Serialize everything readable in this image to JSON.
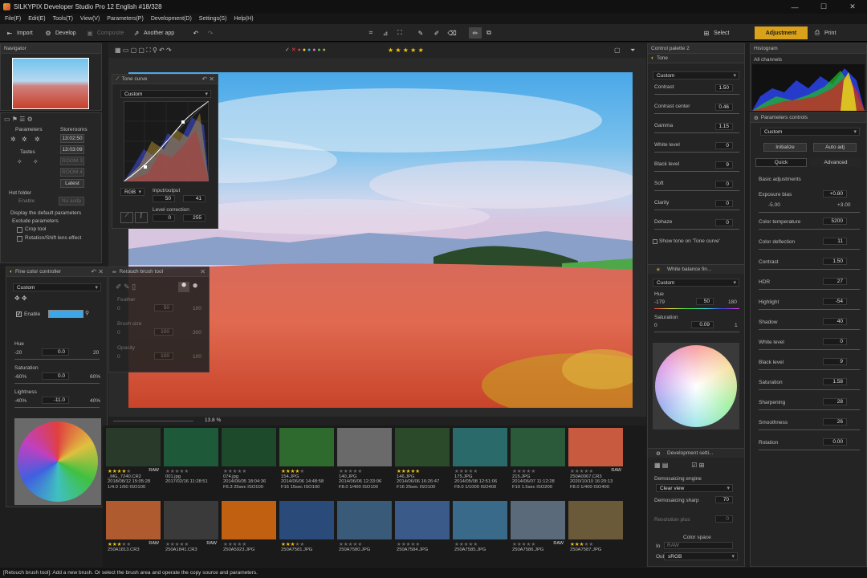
{
  "window": {
    "title": "SILKYPIX Developer Studio Pro 12 English  #18/328",
    "min": "—",
    "max": "☐",
    "close": "✕"
  },
  "menu": [
    "File(F)",
    "Edit(E)",
    "Tools(T)",
    "View(V)",
    "Parameters(P)",
    "Development(D)",
    "Settings(S)",
    "Help(H)"
  ],
  "toolbar": {
    "import": "Import",
    "develop": "Develop",
    "composite": "Composite",
    "another_app": "Another app",
    "select": "Select",
    "adjustment": "Adjustment",
    "print": "Print",
    "accent": "#d9a21a"
  },
  "navigator": {
    "title": "Navigator"
  },
  "left_panel": {
    "parameters": "Parameters",
    "storerooms": "Storerooms",
    "tastes": "Tastes",
    "store_times": [
      "13:02:50",
      "13:03:09",
      "ROOM 3",
      "ROOM 4"
    ],
    "latest": "Latest",
    "hot_folder": "Hot folder",
    "enable": "Enable",
    "no_asdp": "No asdp",
    "display_defaults": "Display the default parameters",
    "exclude": "Exclude parameters",
    "crop_tool": "Crop tool",
    "rotation": "Rotation/Shift lens effect"
  },
  "tone_curve": {
    "title": "Tone curve",
    "preset": "Custom",
    "channel": "RGB",
    "io_label": "Input/output",
    "input": "50",
    "output": "41",
    "level_label": "Level correction",
    "level_min": "0",
    "level_max": "255"
  },
  "fine_color": {
    "title": "Fine color controller",
    "preset": "Custom",
    "enable": "Enable",
    "hue": "Hue",
    "hue_min": "-20",
    "hue_val": "0.0",
    "hue_max": "20",
    "sat": "Saturation",
    "sat_min": "-60%",
    "sat_val": "0.0",
    "sat_max": "60%",
    "light": "Lightness",
    "light_min": "-40%",
    "light_val": "-11.0",
    "light_max": "40%",
    "swatch": "#3ba7e8"
  },
  "retouch": {
    "title": "Retouch brush tool",
    "feather": "Feather",
    "feather_min": "0",
    "feather_val": "50",
    "feather_max": "100",
    "brush": "Brush size",
    "brush_min": "0",
    "brush_val": "100",
    "brush_max": "300",
    "opacity": "Opacity",
    "opacity_min": "0",
    "opacity_val": "100",
    "opacity_max": "100"
  },
  "zoom": {
    "value": "13.8",
    "unit": "%"
  },
  "control_palette": {
    "title": "Control palette 2",
    "tone": {
      "title": "Tone",
      "preset": "Custom",
      "rows": [
        {
          "label": "Contrast",
          "value": "1.50"
        },
        {
          "label": "Contrast center",
          "value": "0.46"
        },
        {
          "label": "Gamma",
          "value": "1.15"
        },
        {
          "label": "White level",
          "value": "0"
        },
        {
          "label": "Black level",
          "value": "9"
        },
        {
          "label": "Soft",
          "value": "0"
        },
        {
          "label": "Clarity",
          "value": "0"
        },
        {
          "label": "Dehaze",
          "value": "0"
        }
      ],
      "show_tone": "Show tone on 'Tone curve'"
    },
    "wb": {
      "title": "White balance fin...",
      "preset": "Custom",
      "hue": "Hue",
      "hue_min": "-179",
      "hue_val": "50",
      "hue_max": "180",
      "sat": "Saturation",
      "sat_min": "0",
      "sat_val": "0.09",
      "sat_max": "1"
    },
    "dev": {
      "title": "Development setti...",
      "demosaic": "Demosaicing engine",
      "demosaic_val": "Clear view",
      "sharp": "Demosaicing sharp",
      "sharp_val": "70",
      "respl": "Resolution plus",
      "respl_val": "0",
      "colorspace": "Color space",
      "in_lbl": "In",
      "in_val": "RAW",
      "out_lbl": "Out",
      "out_val": "sRGB"
    }
  },
  "histogram": {
    "title": "Histogram",
    "channel": "All channels"
  },
  "params_controls": {
    "title": "Parameters controls",
    "preset": "Custom",
    "initialize": "Initialize",
    "auto_adj": "Auto adj",
    "quick": "Quick",
    "advanced": "Advanced",
    "basic": "Basic adjustments",
    "exposure": "Exposure bias",
    "exp_val": "+0.80",
    "exp_min": "-5.00",
    "exp_max": "+3.00",
    "rows": [
      {
        "label": "Color temperature",
        "value": "5200"
      },
      {
        "label": "Color deflection",
        "value": "11"
      },
      {
        "label": "Contrast",
        "value": "1.50"
      },
      {
        "label": "HDR",
        "value": "27"
      },
      {
        "label": "Highlight",
        "value": "-54"
      },
      {
        "label": "Shadow",
        "value": "40"
      },
      {
        "label": "White level",
        "value": "0"
      },
      {
        "label": "Black level",
        "value": "9"
      },
      {
        "label": "Saturation",
        "value": "1.58"
      },
      {
        "label": "Sharpening",
        "value": "28"
      },
      {
        "label": "Smoothness",
        "value": "26"
      },
      {
        "label": "Rotation",
        "value": "0.00"
      }
    ]
  },
  "thumbnails_row1": [
    {
      "stars": 4,
      "raw": "RAW",
      "meta": "_MG_7240.CR2\n2018/08/12 15:05:28\n1/4.0 1/60 ISO100",
      "bg": "#2a3a2a"
    },
    {
      "stars": 0,
      "raw": "",
      "meta": "001.jpg\n2017/02/16 11:28:51",
      "bg": "#1e5a3a"
    },
    {
      "stars": 0,
      "raw": "",
      "meta": "074.jpg\n2014/06/05 18:04:36\nF6.3 25sec ISO100",
      "bg": "#1d4a2a"
    },
    {
      "stars": 4,
      "raw": "",
      "meta": "154.JPG\n2014/06/06 14:48:58\nF16 15sec ISO100",
      "bg": "#2e6a2e"
    },
    {
      "stars": 0,
      "raw": "",
      "meta": "140.JPG\n2014/06/06 12:33:06\nF8.0 1/400 ISO100",
      "bg": "#6a6a6a"
    },
    {
      "stars": 5,
      "raw": "",
      "meta": "146.JPG\n2014/06/06 16:26:47\nF16 25sec ISO100",
      "bg": "#2a4a2a"
    },
    {
      "stars": 0,
      "raw": "",
      "meta": "175.JPG\n2014/05/08 12:51:06\nF8.0 1/1000 ISO400",
      "bg": "#2a6a6a"
    },
    {
      "stars": 0,
      "raw": "",
      "meta": "215.JPG\n2014/06/07 11:12:28\nF10 1.5sec ISO200",
      "bg": "#2a5a3a"
    },
    {
      "stars": 0,
      "raw": "RAW",
      "meta": "250A0067.CR3\n2020/10/10 16:20:13\nF8.0 1/400 ISO400",
      "bg": "#c85a40"
    }
  ],
  "thumbnails_row2": [
    {
      "stars": 3,
      "raw": "RAW",
      "meta": "250A1813.CR3",
      "bg": "#b05a30"
    },
    {
      "stars": 0,
      "raw": "RAW",
      "meta": "250A1841.CR3",
      "bg": "#3a3a3a"
    },
    {
      "stars": 0,
      "raw": "",
      "meta": "250A5923.JPG",
      "bg": "#c06010"
    },
    {
      "stars": 3,
      "raw": "",
      "meta": "250A7581.JPG",
      "bg": "#2a4a7a"
    },
    {
      "stars": 0,
      "raw": "",
      "meta": "250A7580.JPG",
      "bg": "#3a5a7a"
    },
    {
      "stars": 0,
      "raw": "",
      "meta": "250A7584.JPG",
      "bg": "#3a5a8a"
    },
    {
      "stars": 0,
      "raw": "",
      "meta": "250A7585.JPG",
      "bg": "#3a6a8a"
    },
    {
      "stars": 0,
      "raw": "RAW",
      "meta": "250A7586.JPG",
      "bg": "#5a6a7a"
    },
    {
      "stars": 3,
      "raw": "",
      "meta": "250A7587.JPG",
      "bg": "#6a5a3a"
    }
  ],
  "status": "[Retouch brush tool]: Add a new brush. Or select the brush area and operate the copy source and parameters."
}
